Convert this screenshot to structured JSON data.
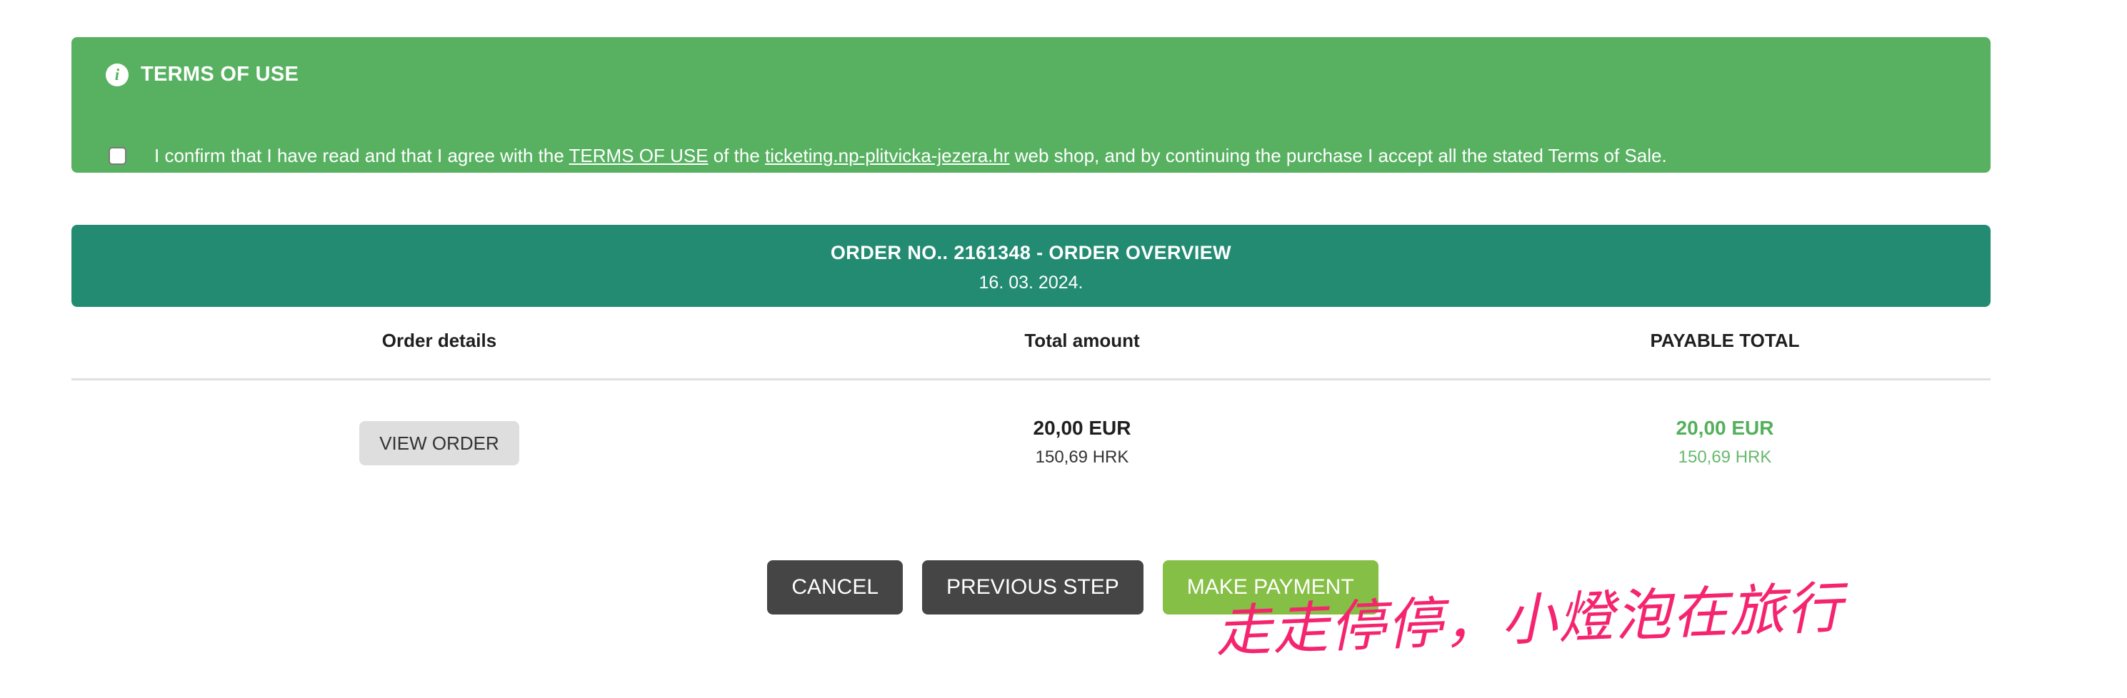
{
  "terms": {
    "icon": "info-circle-icon",
    "title": "TERMS OF USE",
    "checkbox_checked": false,
    "consent_prefix": "I confirm that I have read and that I agree with the ",
    "terms_link": "TERMS OF USE",
    "consent_middle": " of the ",
    "site_link": "ticketing.np-plitvicka-jezera.hr",
    "consent_suffix": " web shop, and by continuing the purchase I accept all the stated Terms of Sale.",
    "background_color": "#57b161"
  },
  "order": {
    "header_title": "ORDER NO.. 2161348 - ORDER OVERVIEW",
    "header_date": "16. 03. 2024.",
    "header_color": "#228b72",
    "columns": {
      "order_details": "Order details",
      "total_amount": "Total amount",
      "payable_total": "PAYABLE TOTAL"
    },
    "row": {
      "view_order_label": "VIEW ORDER",
      "total_primary": "20,00 EUR",
      "total_secondary": "150,69 HRK",
      "payable_primary": "20,00 EUR",
      "payable_secondary": "150,69 HRK",
      "payable_color": "#54b05c"
    }
  },
  "actions": {
    "cancel": "CANCEL",
    "previous_step": "PREVIOUS STEP",
    "make_payment": "MAKE PAYMENT",
    "dark_color": "#454545",
    "green_color": "#86bf45"
  },
  "watermark": {
    "text": "走走停停，小燈泡在旅行",
    "color": "#f5246f"
  }
}
